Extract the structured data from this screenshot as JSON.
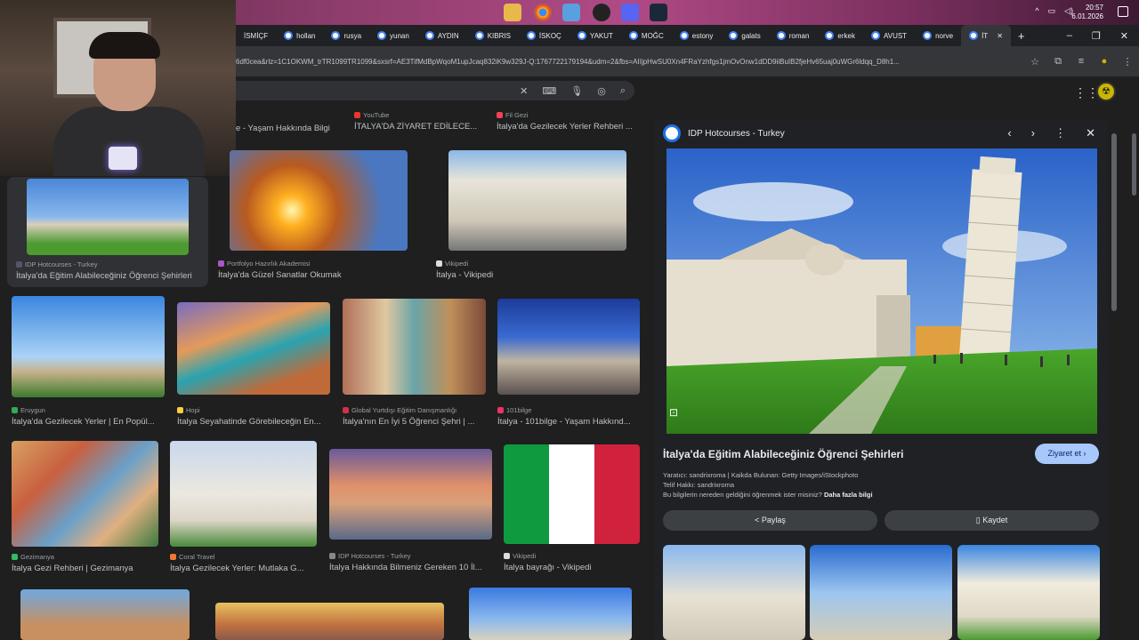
{
  "taskbar": {
    "clock_time": "20:57",
    "clock_date": "6.01.2026",
    "apps": [
      "folder-icon",
      "chrome-icon",
      "app-icon",
      "obs-icon",
      "discord-icon",
      "steam-icon"
    ]
  },
  "tabs": [
    {
      "label": "İSMİÇF"
    },
    {
      "label": "hollan"
    },
    {
      "label": "rusya"
    },
    {
      "label": "yunan"
    },
    {
      "label": "AYDIN"
    },
    {
      "label": "KIBRIS"
    },
    {
      "label": "İSKOÇ"
    },
    {
      "label": "YAKUT"
    },
    {
      "label": "MOĞC"
    },
    {
      "label": "estony"
    },
    {
      "label": "galats"
    },
    {
      "label": "roman"
    },
    {
      "label": "erkek"
    },
    {
      "label": "AVUST"
    },
    {
      "label": "norve"
    },
    {
      "label": "İT"
    }
  ],
  "address": {
    "url": "6df0cea&rlz=1C1OKWM_trTR1099TR1099&sxsrf=AE3TifMdBpWqoM1upJcaq832iK9w329J-Q:1767722179194&udm=2&fbs=AIIjpHwSU0Xn4FRaYzhfgs1jmOvOnw1dDD9iiBuIB2fjeHv65uaj0uWGr6ldqq_D8h1..."
  },
  "results": {
    "top_row": [
      {
        "source": "",
        "title": "e - Yaşam Hakkında Bilgi"
      },
      {
        "source": "YouTube",
        "title": "İTALYA'DA ZİYARET EDİLECE..."
      },
      {
        "source": "Fil Gezi",
        "title": "İtalya'da Gezilecek Yerler Rehberi ..."
      }
    ],
    "row1": [
      {
        "source": "IDP Hotcourses - Turkey",
        "title": "İtalya'da Eğitim Alabileceğiniz Öğrenci Şehirleri"
      },
      {
        "source": "Portfolyo Hazırlık Akademisi",
        "title": "İtalya'da Güzel Sanatlar Okumak"
      },
      {
        "source": "Vikipedi",
        "title": "İtalya - Vikipedi"
      }
    ],
    "row2": [
      {
        "source": "Eruygun",
        "title": "İtalya'da Gezilecek Yerler | En Popül..."
      },
      {
        "source": "Hopi",
        "title": "İtalya Seyahatinde Görebileceğin En..."
      },
      {
        "source": "Global Yurtdışı Eğitim Danışmanlığı",
        "title": "İtalya'nın En İyi 5 Öğrenci Şehri | ..."
      },
      {
        "source": "101bilge",
        "title": "İtalya - 101bilge - Yaşam Hakkınd..."
      }
    ],
    "row3": [
      {
        "source": "Gezimanya",
        "title": "İtalya Gezi Rehberi | Gezimanya"
      },
      {
        "source": "Coral Travel",
        "title": "İtalya Gezilecek Yerler: Mutlaka G..."
      },
      {
        "source": "IDP Hotcourses - Turkey",
        "title": "İtalya Hakkında Bilmeniz Gereken 10 İl..."
      },
      {
        "source": "Vikipedi",
        "title": "İtalya bayrağı - Vikipedi"
      }
    ]
  },
  "panel": {
    "source": "IDP Hotcourses - Turkey",
    "title": "İtalya'da Eğitim Alabileceğiniz Öğrenci Şehirleri",
    "visit_label": "Ziyaret et",
    "meta_line1": "Yaratıcı: sandrixroma | Kaikda Bulunan: Getty Images/iStockphoto",
    "meta_line2": "Telif Hakkı: sandrixroma",
    "meta_line3": "Bu bilgilerin nereden geldiğini öğrenmek ister misiniz?",
    "meta_link": "Daha fazla bilgi",
    "share_label": "Paylaş",
    "save_label": "Kaydet"
  },
  "colors": {
    "accent": "#a8c7fa",
    "panel_bg": "#202124",
    "page_bg": "#1f1f1f"
  }
}
